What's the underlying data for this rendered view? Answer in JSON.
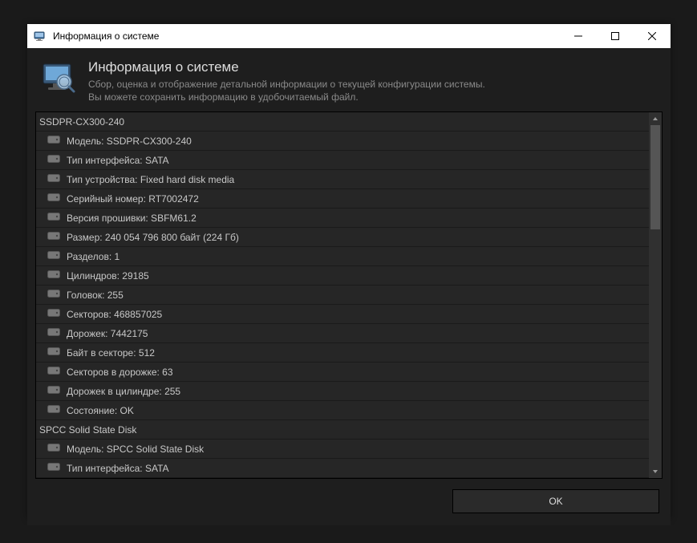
{
  "window": {
    "title": "Информация о системе"
  },
  "header": {
    "title": "Информация о системе",
    "line1": "Сбор, оценка и отображение детальной информации о текущей конфигурации системы.",
    "line2": "Вы можете сохранить информацию в удобочитаемый файл."
  },
  "list": [
    {
      "type": "group",
      "text": "SSDPR-CX300-240"
    },
    {
      "type": "item",
      "text": "Модель: SSDPR-CX300-240"
    },
    {
      "type": "item",
      "text": "Тип интерфейса: SATA"
    },
    {
      "type": "item",
      "text": "Тип устройства: Fixed hard disk media"
    },
    {
      "type": "item",
      "text": "Серийный номер: RT7002472"
    },
    {
      "type": "item",
      "text": "Версия прошивки: SBFM61.2"
    },
    {
      "type": "item",
      "text": "Размер: 240 054 796 800 байт (224 Гб)"
    },
    {
      "type": "item",
      "text": "Разделов: 1"
    },
    {
      "type": "item",
      "text": "Цилиндров: 29185"
    },
    {
      "type": "item",
      "text": "Головок: 255"
    },
    {
      "type": "item",
      "text": "Секторов: 468857025"
    },
    {
      "type": "item",
      "text": "Дорожек: 7442175"
    },
    {
      "type": "item",
      "text": "Байт в секторе: 512"
    },
    {
      "type": "item",
      "text": "Секторов в дорожке: 63"
    },
    {
      "type": "item",
      "text": "Дорожек в цилиндре: 255"
    },
    {
      "type": "item",
      "text": "Состояние: OK"
    },
    {
      "type": "group",
      "text": "SPCC Solid State Disk"
    },
    {
      "type": "item",
      "text": "Модель: SPCC Solid State Disk"
    },
    {
      "type": "item",
      "text": "Тип интерфейса: SATA"
    }
  ],
  "footer": {
    "ok": "OK"
  }
}
